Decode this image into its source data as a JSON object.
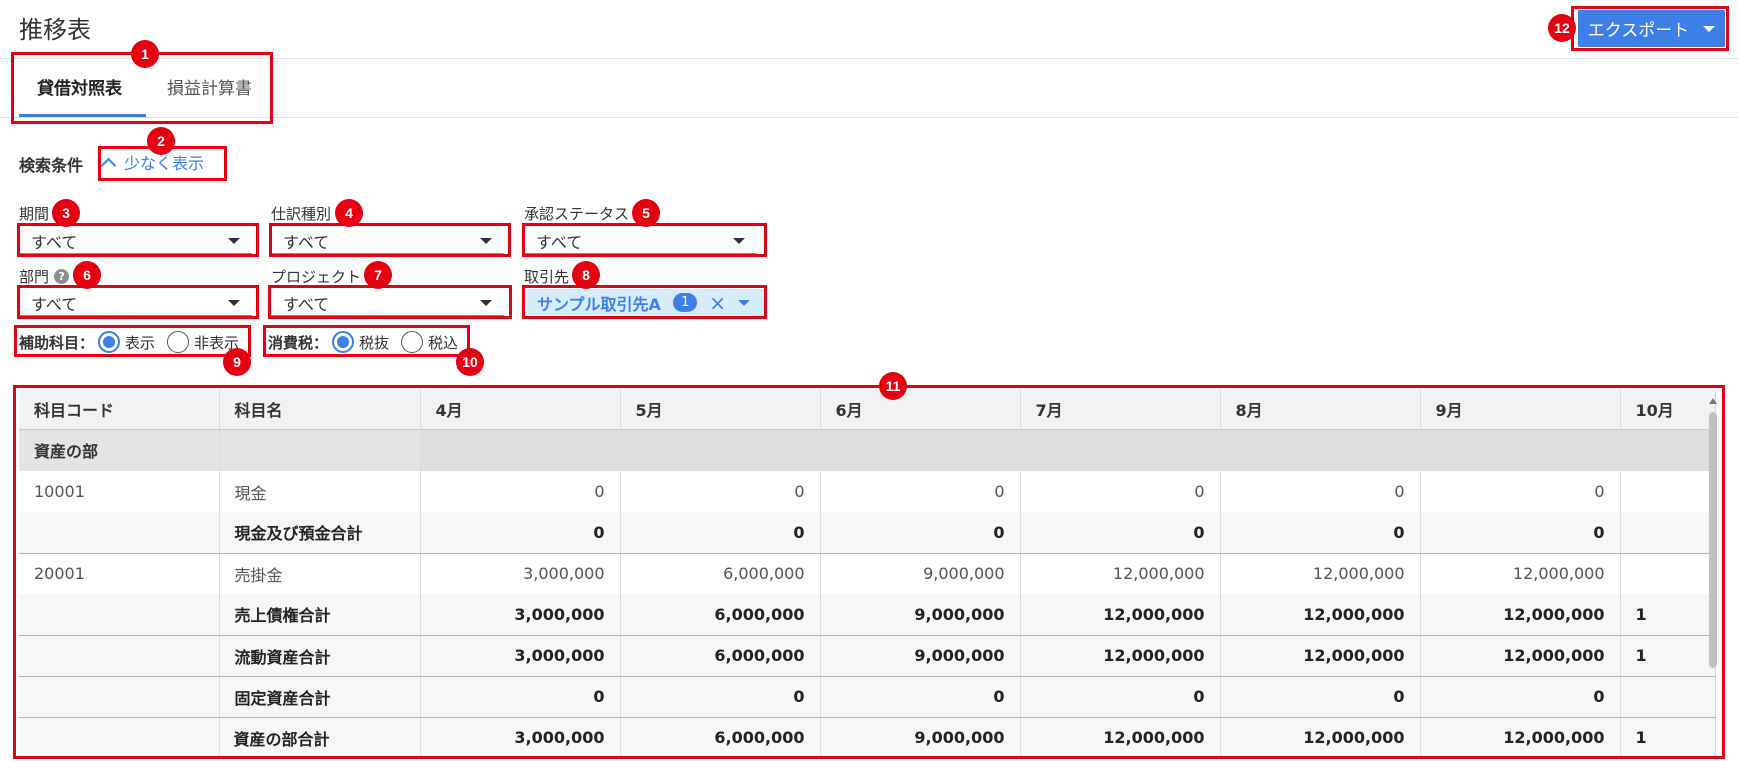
{
  "page": {
    "title": "推移表",
    "export_label": "エクスポート",
    "tabs": [
      {
        "label": "貸借対照表",
        "active": true
      },
      {
        "label": "損益計算書",
        "active": false
      }
    ],
    "search_label": "検索条件",
    "toggle_label": "少なく表示",
    "accent_color": "#3d7fe6",
    "highlight_color": "#e60012"
  },
  "filters": {
    "period": {
      "label": "期間",
      "value": "すべて"
    },
    "journal_type": {
      "label": "仕訳種別",
      "value": "すべて"
    },
    "approval_status": {
      "label": "承認ステータス",
      "value": "すべて"
    },
    "department": {
      "label": "部門",
      "help": "?",
      "value": "すべて"
    },
    "project": {
      "label": "プロジェクト",
      "value": "すべて"
    },
    "partner": {
      "label": "取引先",
      "chip": "サンプル取引先A",
      "count": "1",
      "clear": "×"
    }
  },
  "radios": {
    "sub_account": {
      "label": "補助科目：",
      "options": [
        "表示",
        "非表示"
      ],
      "selected": 0
    },
    "tax": {
      "label": "消費税：",
      "options": [
        "税抜",
        "税込"
      ],
      "selected": 0
    }
  },
  "badges": [
    "1",
    "2",
    "3",
    "4",
    "5",
    "6",
    "7",
    "8",
    "9",
    "10",
    "11",
    "12"
  ],
  "table": {
    "headers": [
      "科目コード",
      "科目名",
      "4月",
      "5月",
      "6月",
      "7月",
      "8月",
      "9月",
      "10月"
    ],
    "rows": [
      {
        "type": "section",
        "code": "資産の部",
        "name": "",
        "values": []
      },
      {
        "type": "item",
        "code": "10001",
        "name": "現金",
        "values": [
          "0",
          "0",
          "0",
          "0",
          "0",
          "0",
          ""
        ]
      },
      {
        "type": "total",
        "code": "",
        "name": "現金及び預金合計",
        "values": [
          "0",
          "0",
          "0",
          "0",
          "0",
          "0",
          ""
        ]
      },
      {
        "type": "item",
        "code": "20001",
        "name": "売掛金",
        "values": [
          "3,000,000",
          "6,000,000",
          "9,000,000",
          "12,000,000",
          "12,000,000",
          "12,000,000",
          ""
        ]
      },
      {
        "type": "total",
        "code": "",
        "name": "売上債権合計",
        "values": [
          "3,000,000",
          "6,000,000",
          "9,000,000",
          "12,000,000",
          "12,000,000",
          "12,000,000",
          "1"
        ]
      },
      {
        "type": "total",
        "code": "",
        "name": "流動資産合計",
        "values": [
          "3,000,000",
          "6,000,000",
          "9,000,000",
          "12,000,000",
          "12,000,000",
          "12,000,000",
          "1"
        ]
      },
      {
        "type": "total",
        "code": "",
        "name": "固定資産合計",
        "values": [
          "0",
          "0",
          "0",
          "0",
          "0",
          "0",
          ""
        ]
      },
      {
        "type": "total",
        "code": "",
        "name": "資産の部合計",
        "values": [
          "3,000,000",
          "6,000,000",
          "9,000,000",
          "12,000,000",
          "12,000,000",
          "12,000,000",
          "1"
        ]
      }
    ]
  }
}
